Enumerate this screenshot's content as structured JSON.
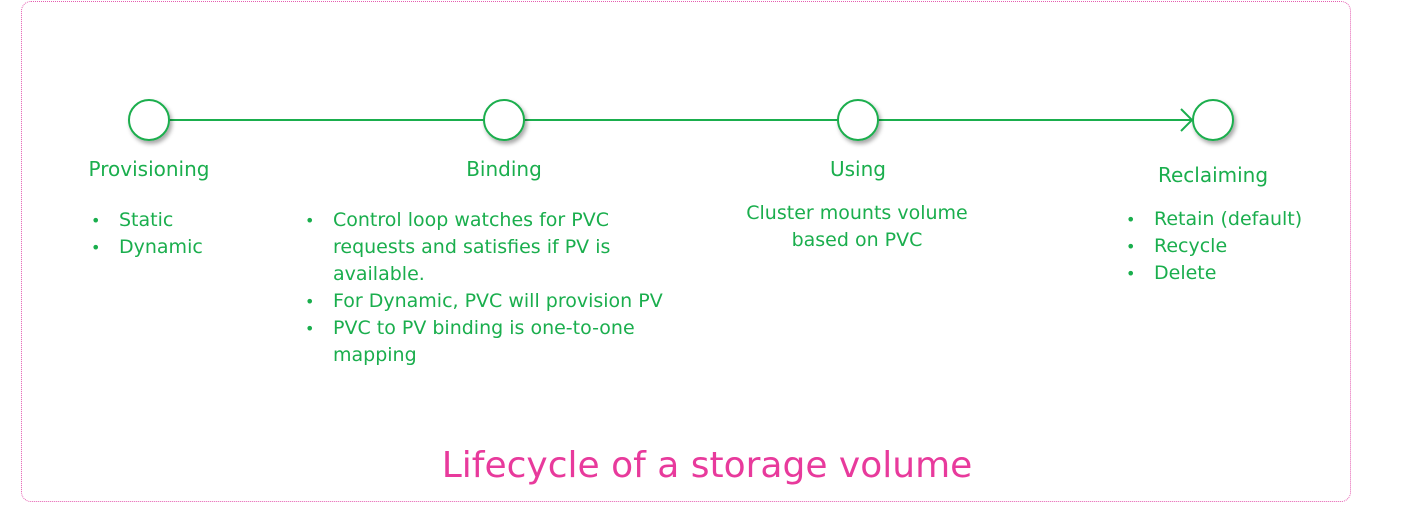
{
  "colors": {
    "accent_green": "#1aae4d",
    "caption_pink": "#e83a9c",
    "frame_pink": "#e55cb0"
  },
  "caption": "Lifecycle of a storage volume",
  "stages": [
    {
      "title": "Provisioning",
      "bullets": [
        "Static",
        "Dynamic"
      ]
    },
    {
      "title": "Binding",
      "bullets": [
        "Control loop watches for PVC requests and satisfies if PV is available.",
        "For Dynamic, PVC will provision PV",
        "PVC to PV binding is one-to-one mapping"
      ]
    },
    {
      "title": "Using",
      "description_lines": [
        "Cluster mounts volume",
        "based on PVC"
      ]
    },
    {
      "title": "Reclaiming",
      "bullets": [
        "Retain (default)",
        "Recycle",
        "Delete"
      ]
    }
  ],
  "icons": {
    "stage_marker": "circle-node-icon",
    "flow_end": "arrowhead-icon"
  }
}
